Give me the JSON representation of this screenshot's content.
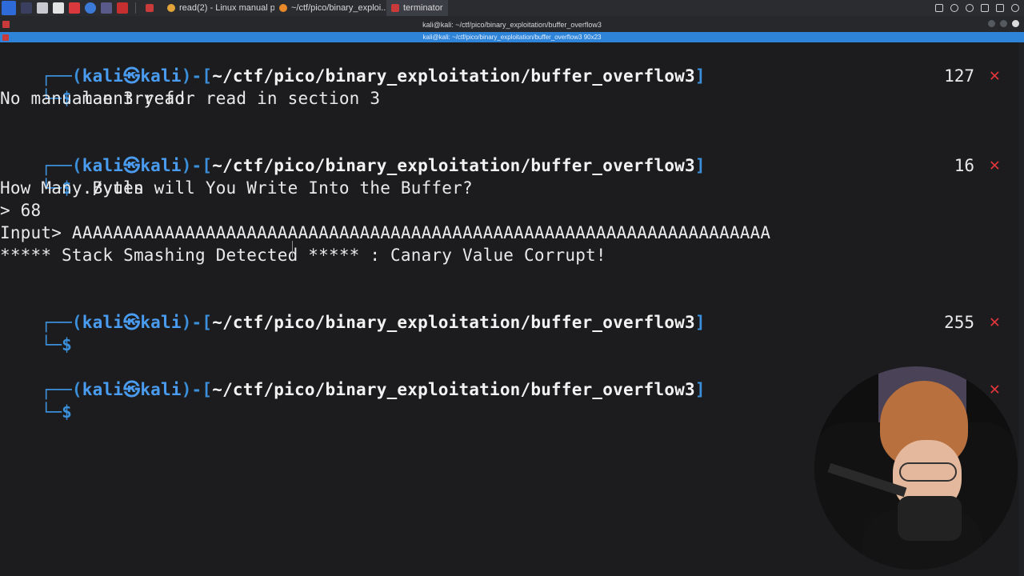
{
  "taskbar": {
    "tasks": [
      {
        "label": "read(2) - Linux manual p..."
      },
      {
        "label": "~/ctf/pico/binary_exploi..."
      },
      {
        "label": "terminator"
      }
    ]
  },
  "window": {
    "title": "kali@kali: ~/ctf/pico/binary_exploitation/buffer_overflow3",
    "tab_title": "kali@kali: ~/ctf/pico/binary_exploitation/buffer_overflow3 90x23"
  },
  "terminal": {
    "prompt": {
      "open": "┌──(",
      "userhost": "kali㉿kali",
      "mid": ")-[",
      "cwd": "~/ctf/pico/binary_exploitation/buffer_overflow3",
      "close": "]",
      "corner": "└─",
      "dollar": "$"
    },
    "blocks": [
      {
        "command": "man 3 read",
        "exit_code": "127"
      },
      {
        "command": "./vuln",
        "exit_code": "16"
      },
      {
        "command": "",
        "exit_code": "255"
      },
      {
        "command": "",
        "exit_code": ""
      }
    ],
    "output": {
      "no_manual": "No manual entry for read in section 3",
      "how_many": "How Many Bytes will You Write Into the Buffer?",
      "answer": "> 68",
      "input_line": "Input> AAAAAAAAAAAAAAAAAAAAAAAAAAAAAAAAAAAAAAAAAAAAAAAAAAAAAAAAAAAAAAAAAAAA",
      "smashing": "***** Stack Smashing Detected ***** : Canary Value Corrupt!"
    },
    "x_glyph": "✕"
  },
  "colors": {
    "accent_blue": "#2d84d9",
    "prompt_blue": "#3b8fdb",
    "error_red": "#e0353a",
    "background": "#1c1c1e"
  }
}
